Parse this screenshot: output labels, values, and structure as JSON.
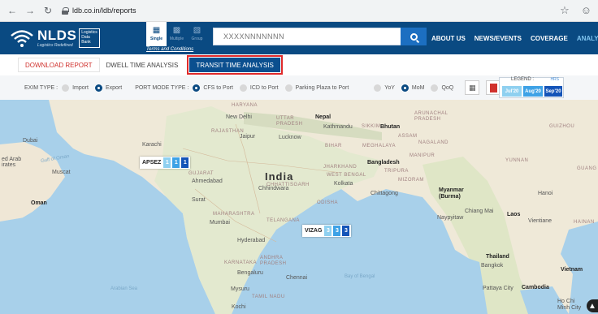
{
  "browser": {
    "back_icon": "back-arrow-icon",
    "forward_icon": "forward-arrow-icon",
    "reload_icon": "reload-icon",
    "url": "ldb.co.in/ldb/reports"
  },
  "header": {
    "brand": "NLDS",
    "brand_tagline": "Logistics Redefined",
    "brand_box_lines": [
      "Logistics",
      "Data",
      "Bank"
    ],
    "modes": [
      {
        "label": "Single",
        "icon": "single-container-icon"
      },
      {
        "label": "Multiple",
        "icon": "multiple-container-icon"
      },
      {
        "label": "Group",
        "icon": "group-container-icon"
      }
    ],
    "terms": "Terms and Conditions",
    "search_placeholder": "XXXXNNNNNNN",
    "nav": [
      "ABOUT US",
      "NEWS/EVENTS",
      "COVERAGE",
      "ANALYTIC"
    ]
  },
  "tabs": {
    "download": "DOWNLOAD REPORT",
    "dwell": "DWELL TIME ANALYSIS",
    "transit": "TRANSIT TIME ANALYSIS"
  },
  "filters": {
    "exim_label": "EXIM TYPE :",
    "import": "Import",
    "export": "Export",
    "port_mode_label": "PORT MODE TYPE :",
    "cfs": "CFS to Port",
    "icd": "ICD to Port",
    "parking": "Parking Plaza to Port",
    "yoy": "YoY",
    "mom": "MoM",
    "qoq": "QoQ",
    "legend_title": "LEGEND :",
    "legend_unit": "HRS",
    "legend_items": [
      {
        "label": "Jul'20",
        "color": "#8fd0f0"
      },
      {
        "label": "Aug'20",
        "color": "#3ea2e6"
      },
      {
        "label": "Sep'20",
        "color": "#1454b8"
      }
    ]
  },
  "map": {
    "labels": {
      "india": "India",
      "nepal": "Nepal",
      "bhutan": "Bhutan",
      "bangladesh": "Bangladesh",
      "myanmar": "Myanmar\n(Burma)",
      "thailand": "Thailand",
      "laos": "Laos",
      "vietnam": "Vietnam",
      "cambodia": "Cambodia",
      "oman": "Oman",
      "dubai": "Dubai",
      "muscat": "Muscat",
      "karachi": "Karachi",
      "new_delhi": "New Delhi",
      "jaipur": "Jaipur",
      "lucknow": "Lucknow",
      "kathmandu": "Kathmandu",
      "kolkata": "Kolkata",
      "ahmedabad": "Ahmedabad",
      "surat": "Surat",
      "mumbai": "Mumbai",
      "hyderabad": "Hyderabad",
      "bengaluru": "Bengaluru",
      "chennai": "Chennai",
      "mysuru": "Mysuru",
      "kochi": "Kochi",
      "bangkok": "Bangkok",
      "vientiane": "Vientiane",
      "hanoi": "Hanoi",
      "chiang_mai": "Chiang Mai",
      "pattaya": "Pattaya City",
      "ho_chi_minh": "Ho Chi\nMinh City",
      "naypyitaw": "Naypyitaw",
      "chittagong": "Chittagong",
      "bay_of_bengal": "Bay of Bengal",
      "arabian_sea": "Arabian Sea",
      "gulf_of_oman": "Gulf of Oman",
      "yunnan": "YUNNAN",
      "guizhou": "GUIZHOU",
      "guangxi": "GUANG",
      "hainan": "HAINAN",
      "haryana": "HARYANA",
      "uttar_pradesh": "UTTAR\nPRADESH",
      "rajasthan": "RAJASTHAN",
      "bihar": "BIHAR",
      "meghalaya": "MEGHALAYA",
      "jharkhand": "JHARKHAND",
      "west_bengal": "WEST BENGAL",
      "chhattisgarh": "CHHATTISGARH",
      "odisha": "ODISHA",
      "gujarat": "GUJARAT",
      "maharashtra": "MAHARASHTRA",
      "telangana": "TELANGANA",
      "andhra_pradesh": "ANDHRA\nPRADESH",
      "karnataka": "KARNATAKA",
      "tamil_nadu": "TAMIL NADU",
      "assam": "ASSAM",
      "arunachal": "ARUNACHAL\nPRADESH",
      "nagaland": "NAGALAND",
      "manipur": "MANIPUR",
      "mizoram": "MIZORAM",
      "tripura": "TRIPURA",
      "sikkim": "SIKKIM",
      "arab_emirates": "ed Arab\nirates",
      "chhindwara": "Chhindwara"
    },
    "markers": [
      {
        "name": "APSEZ",
        "values": [
          "1",
          "1",
          "1"
        ]
      },
      {
        "name": "VIZAG",
        "values": [
          "3",
          "3",
          "3"
        ]
      }
    ]
  }
}
